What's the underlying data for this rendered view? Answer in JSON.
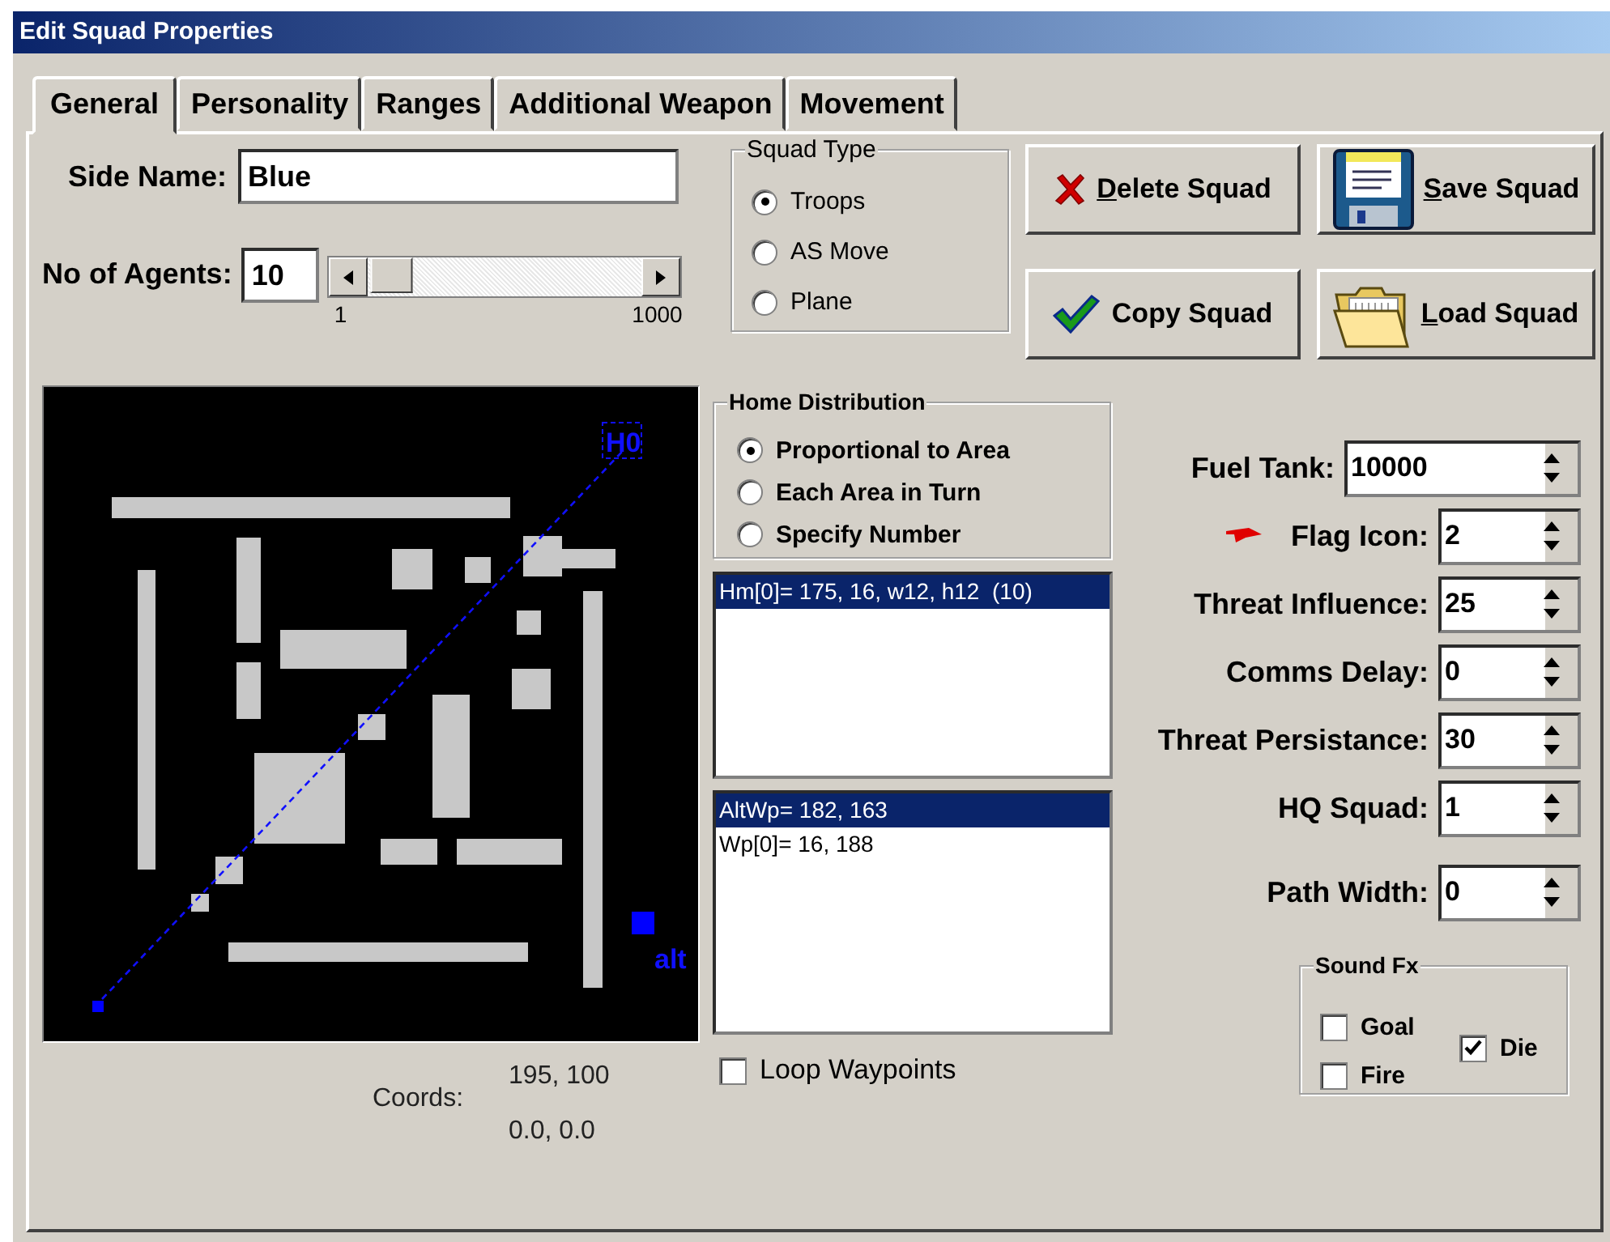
{
  "window": {
    "title": "Edit Squad Properties"
  },
  "tabs": [
    {
      "label": "General",
      "selected": true
    },
    {
      "label": "Personality",
      "selected": false
    },
    {
      "label": "Ranges",
      "selected": false
    },
    {
      "label": "Additional Weapon",
      "selected": false
    },
    {
      "label": "Movement",
      "selected": false
    }
  ],
  "side_name": {
    "label": "Side Name:",
    "value": "Blue"
  },
  "agents": {
    "label": "No of Agents:",
    "value": "10",
    "level": 0.01,
    "min_label": "1",
    "max_label": "1000"
  },
  "squad_type": {
    "title": "Squad Type",
    "options": [
      {
        "label": "Troops",
        "selected": true
      },
      {
        "label": "AS Move",
        "selected": false
      },
      {
        "label": "Plane",
        "selected": false
      }
    ]
  },
  "buttons": [
    {
      "label": "Delete Squad",
      "kind": "delete",
      "underline_first": true
    },
    {
      "label": "Save Squad",
      "kind": "save",
      "underline_first": true
    },
    {
      "label": "Copy Squad",
      "kind": "copy",
      "underline_first": false
    },
    {
      "label": "Load Squad",
      "kind": "load",
      "underline_first": true
    }
  ],
  "map": {
    "hq_label": "H0",
    "alt_label": "alt"
  },
  "coords": {
    "label": "Coords:",
    "values": [
      "195, 100",
      "0.0, 0.0"
    ]
  },
  "home_distribution": {
    "title": "Home Distribution",
    "options": [
      {
        "label": "Proportional to Area",
        "selected": true
      },
      {
        "label": "Each Area in Turn",
        "selected": false
      },
      {
        "label": "Specify Number",
        "selected": false
      }
    ]
  },
  "home_list": [
    {
      "text": "Hm[0]= 175, 16, w12, h12  (10)",
      "selected": true
    }
  ],
  "waypoint_list": [
    {
      "text": "AltWp= 182, 163",
      "selected": true
    },
    {
      "text": "Wp[0]= 16, 188",
      "selected": false
    }
  ],
  "loop_waypoints": {
    "label": "Loop Waypoints",
    "checked": false
  },
  "fields": [
    {
      "label": "Fuel Tank:",
      "value": "10000",
      "kind": "wide"
    },
    {
      "label": "Flag Icon:",
      "value": "2",
      "kind": "flag"
    },
    {
      "label": "Threat Influence:",
      "value": "25",
      "kind": "plain"
    },
    {
      "label": "Comms Delay:",
      "value": "0",
      "kind": "plain"
    },
    {
      "label": "Threat Persistance:",
      "value": "30",
      "kind": "plain"
    },
    {
      "label": "HQ Squad:",
      "value": "1",
      "kind": "plain"
    },
    {
      "label": "Path Width:",
      "value": "0",
      "kind": "spaced"
    }
  ],
  "sound_fx": {
    "title": "Sound Fx",
    "options": [
      {
        "label": "Goal",
        "checked": false
      },
      {
        "label": "Fire",
        "checked": false
      },
      {
        "label": "Die",
        "checked": true
      }
    ]
  }
}
